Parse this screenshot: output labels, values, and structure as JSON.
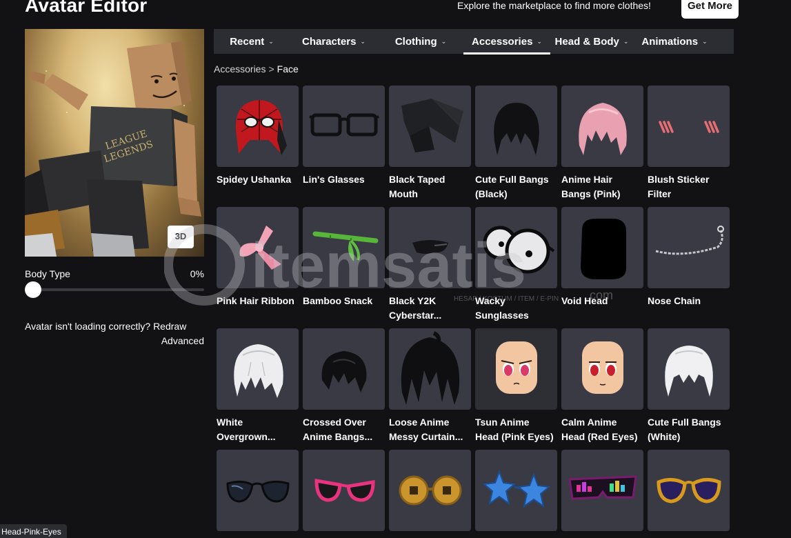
{
  "header": {
    "title": "Avatar Editor",
    "promo_text": "Explore the marketplace to find more clothes!",
    "get_more_label": "Get More"
  },
  "preview": {
    "button_3d": "3D",
    "body_type_label": "Body Type",
    "body_type_value": "0%",
    "body_type_fraction": 0.0,
    "loading_text": "Avatar isn't loading correctly?",
    "redraw_label": "Redraw",
    "advanced_label": "Advanced",
    "shirt_text_top": "LEAGUE",
    "shirt_text_bottom": "LEGENDS"
  },
  "tabs": [
    {
      "label": "Recent",
      "active": false
    },
    {
      "label": "Characters",
      "active": false
    },
    {
      "label": "Clothing",
      "active": false
    },
    {
      "label": "Accessories",
      "active": true
    },
    {
      "label": "Head & Body",
      "active": false
    },
    {
      "label": "Animations",
      "active": false
    }
  ],
  "breadcrumb": {
    "parent": "Accessories",
    "separator": ">",
    "current": "Face"
  },
  "items": [
    {
      "name_line1": "Spidey Ushanka",
      "name_line2": "",
      "icon": "red-spider-hat-icon"
    },
    {
      "name_line1": "Lin's Glasses",
      "name_line2": "",
      "icon": "black-glasses-icon"
    },
    {
      "name_line1": "Black Taped",
      "name_line2": "Mouth",
      "icon": "tape-mouth-icon"
    },
    {
      "name_line1": "Cute Full Bangs",
      "name_line2": "(Black)",
      "icon": "black-bangs-icon"
    },
    {
      "name_line1": "Anime Hair",
      "name_line2": "Bangs (Pink)",
      "icon": "pink-bangs-icon"
    },
    {
      "name_line1": "Blush Sticker",
      "name_line2": "Filter",
      "icon": "blush-sticker-icon"
    },
    {
      "name_line1": "Pink Hair Ribbon",
      "name_line2": "",
      "icon": "pink-ribbon-icon"
    },
    {
      "name_line1": "Bamboo Snack",
      "name_line2": "",
      "icon": "bamboo-icon"
    },
    {
      "name_line1": "Black Y2K",
      "name_line2": "Cyberstar...",
      "icon": "y2k-shades-icon"
    },
    {
      "name_line1": "Wacky",
      "name_line2": "Sunglasses",
      "icon": "wacky-glasses-icon"
    },
    {
      "name_line1": "Void Head",
      "name_line2": "",
      "icon": "void-head-icon"
    },
    {
      "name_line1": "Nose Chain",
      "name_line2": "",
      "icon": "nose-chain-icon"
    },
    {
      "name_line1": "White",
      "name_line2": "Overgrown...",
      "icon": "white-hair-icon"
    },
    {
      "name_line1": "Crossed Over",
      "name_line2": "Anime Bangs...",
      "icon": "black-crossed-bangs-icon"
    },
    {
      "name_line1": "Loose Anime",
      "name_line2": "Messy Curtain...",
      "icon": "black-messy-hair-icon"
    },
    {
      "name_line1": "Tsun Anime",
      "name_line2": "Head (Pink Eyes)",
      "icon": "anime-head-pink-icon"
    },
    {
      "name_line1": "Calm Anime",
      "name_line2": "Head (Red Eyes)",
      "icon": "anime-head-red-icon"
    },
    {
      "name_line1": "Cute Full Bangs",
      "name_line2": "(White)",
      "icon": "white-bangs-icon"
    },
    {
      "name_line1": "",
      "name_line2": "",
      "icon": "aviator-shades-icon"
    },
    {
      "name_line1": "",
      "name_line2": "",
      "icon": "pink-shades-icon"
    },
    {
      "name_line1": "",
      "name_line2": "",
      "icon": "coin-glasses-icon"
    },
    {
      "name_line1": "",
      "name_line2": "",
      "icon": "star-glasses-icon"
    },
    {
      "name_line1": "",
      "name_line2": "",
      "icon": "led-shades-icon"
    },
    {
      "name_line1": "",
      "name_line2": "",
      "icon": "gold-shades-icon"
    }
  ],
  "watermark": {
    "text": "itemsatis",
    "sub": "HESAP / KOSTUM / ITEM / E-PIN",
    "suffix": ".com"
  },
  "tooltip": "Head-Pink-Eyes",
  "colors": {
    "background": "#121215",
    "panel": "#2b2d33",
    "tile": "#393a43",
    "accent": "#ffffff"
  }
}
